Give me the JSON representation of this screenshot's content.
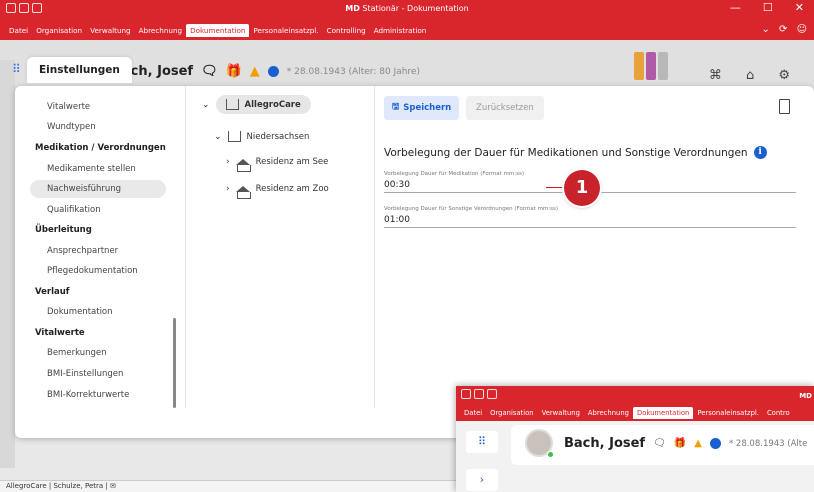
{
  "app": {
    "title_bold": "MD",
    "title_rest": " Stationär - Dokumentation",
    "window_controls": [
      "—",
      "☐",
      "✕"
    ]
  },
  "menu": [
    {
      "label": "Datei",
      "active": false
    },
    {
      "label": "Organisation",
      "active": false
    },
    {
      "label": "Verwaltung",
      "active": false
    },
    {
      "label": "Abrechnung",
      "active": false
    },
    {
      "label": "Dokumentation",
      "active": true
    },
    {
      "label": "Personaleinsatzpl.",
      "active": false
    },
    {
      "label": "Controlling",
      "active": false
    },
    {
      "label": "Administration",
      "active": false
    }
  ],
  "patient": {
    "name": "Bach, Josef",
    "birth": "* 28.08.1943 (Alter: 80 Jahre)"
  },
  "modal": {
    "tab_label": "Einstellungen"
  },
  "nav": [
    {
      "label": "Vitalwerte",
      "type": "item",
      "selected": false
    },
    {
      "label": "Wundtypen",
      "type": "item",
      "selected": false
    },
    {
      "label": "Medikation / Verordnungen",
      "type": "head",
      "selected": false
    },
    {
      "label": "Medikamente stellen",
      "type": "item",
      "selected": false
    },
    {
      "label": "Nachweisführung",
      "type": "item",
      "selected": true
    },
    {
      "label": "Qualifikation",
      "type": "item",
      "selected": false
    },
    {
      "label": "Überleitung",
      "type": "head",
      "selected": false
    },
    {
      "label": "Ansprechpartner",
      "type": "item",
      "selected": false
    },
    {
      "label": "Pflegedokumentation",
      "type": "item",
      "selected": false
    },
    {
      "label": "Verlauf",
      "type": "head",
      "selected": false
    },
    {
      "label": "Dokumentation",
      "type": "item",
      "selected": false
    },
    {
      "label": "Vitalwerte",
      "type": "head",
      "selected": false
    },
    {
      "label": "Bemerkungen",
      "type": "item",
      "selected": false
    },
    {
      "label": "BMI-Einstellungen",
      "type": "item",
      "selected": false
    },
    {
      "label": "BMI-Korrekturwerte",
      "type": "item",
      "selected": false
    }
  ],
  "tree": {
    "root": "AllegroCare",
    "region": "Niedersachsen",
    "facilities": [
      "Residenz am See",
      "Residenz am Zoo"
    ]
  },
  "toolbar": {
    "save_label": "Speichern",
    "reset_label": "Zurücksetzen"
  },
  "section": {
    "title": "Vorbelegung der Dauer für Medikationen und Sonstige Verordnungen",
    "fields": [
      {
        "label": "Vorbelegung Dauer für Medikation (Format mm:ss)",
        "value": "00:30"
      },
      {
        "label": "Vorbelegung Dauer für Sonstige Verordnungen (Format mm:ss)",
        "value": "01:00"
      }
    ]
  },
  "callout": {
    "number": "1"
  },
  "statusbar": {
    "text": "AllegroCare | Schulze, Petra |"
  },
  "inset": {
    "title": "MD",
    "menu": [
      {
        "label": "Datei",
        "active": false
      },
      {
        "label": "Organisation",
        "active": false
      },
      {
        "label": "Verwaltung",
        "active": false
      },
      {
        "label": "Abrechnung",
        "active": false
      },
      {
        "label": "Dokumentation",
        "active": true
      },
      {
        "label": "Personaleinsatzpl.",
        "active": false
      },
      {
        "label": "Contro",
        "active": false
      }
    ],
    "patient_name": "Bach, Josef",
    "patient_birth": "* 28.08.1943 (Alte"
  },
  "colors": {
    "brand_red": "#d9262c",
    "accent_blue": "#1a5fd0",
    "selected_bg": "#e9e9e9"
  }
}
